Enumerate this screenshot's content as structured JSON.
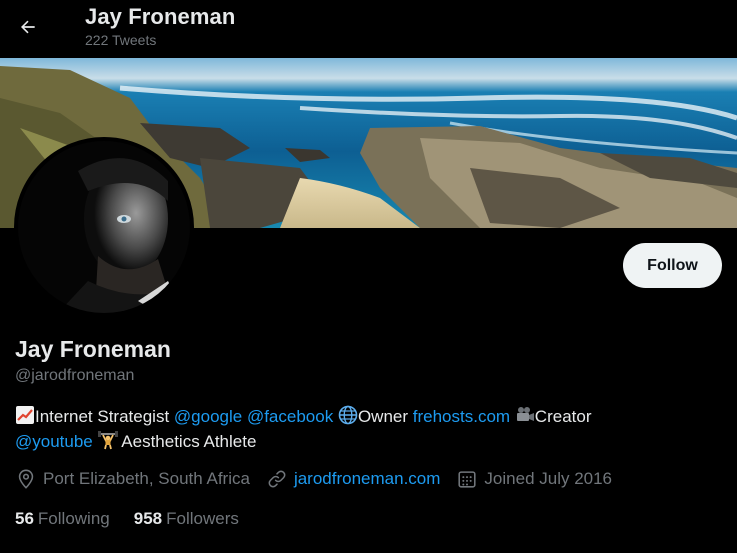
{
  "header": {
    "name": "Jay Froneman",
    "tweet_count": "222 Tweets"
  },
  "profile": {
    "display_name": "Jay Froneman",
    "handle": "@jarodfroneman",
    "follow_label": "Follow",
    "bio": {
      "line1": [
        {
          "type": "emoji",
          "icon": "chart-increasing-icon"
        },
        {
          "type": "text",
          "text": "Internet Strategist "
        },
        {
          "type": "mention",
          "text": "@google"
        },
        {
          "type": "text",
          "text": " "
        },
        {
          "type": "mention",
          "text": "@facebook"
        },
        {
          "type": "text",
          "text": " "
        },
        {
          "type": "emoji",
          "icon": "globe-icon"
        },
        {
          "type": "text",
          "text": "Owner "
        },
        {
          "type": "mention",
          "text": "frehosts.com"
        },
        {
          "type": "text",
          "text": " "
        },
        {
          "type": "emoji",
          "icon": "movie-camera-icon"
        },
        {
          "type": "text",
          "text": "Creator"
        }
      ],
      "line2": [
        {
          "type": "mention",
          "text": "@youtube"
        },
        {
          "type": "text",
          "text": " "
        },
        {
          "type": "emoji",
          "icon": "weightlifter-icon"
        },
        {
          "type": "text",
          "text": " Aesthetics Athlete"
        }
      ]
    },
    "location": "Port Elizabeth, South Africa",
    "website": "jarodfroneman.com",
    "joined": "Joined July 2016",
    "following_count": "56",
    "following_label": "Following",
    "followers_count": "958",
    "followers_label": "Followers"
  },
  "colors": {
    "accent": "#1d9bf0",
    "background": "#000000",
    "secondary_text": "#71767b",
    "primary_text": "#e7e9ea"
  }
}
